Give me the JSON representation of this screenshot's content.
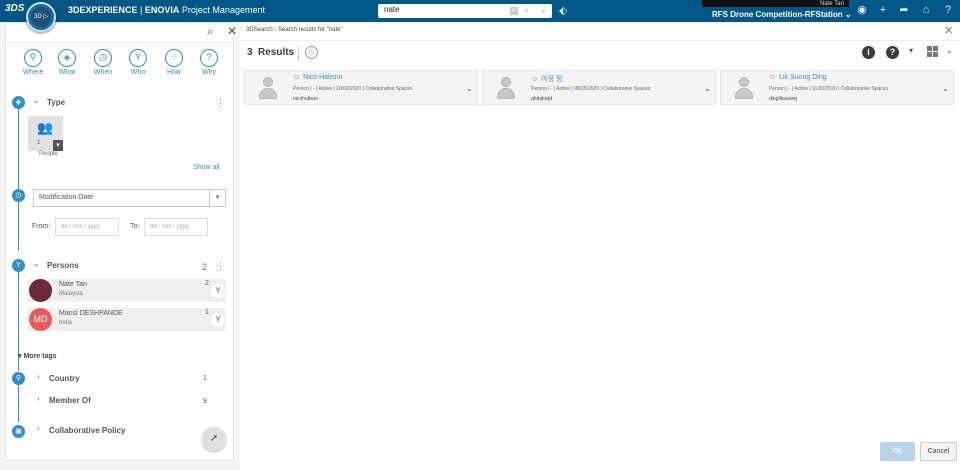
{
  "topbar": {
    "logo": "3DS",
    "compass_label": "3D  ▷  V,R",
    "brand": "3DEXPERIENCE",
    "app": "ENOVIA",
    "app_name": "Project Management",
    "search_value": "nate",
    "user": "Nate Tan",
    "collab_space": "RFS Drone Competition-RFStation",
    "icons": [
      "tag-icon",
      "user-icon",
      "plus-icon",
      "share-icon",
      "home-icon",
      "help-icon"
    ]
  },
  "filters": {
    "wtabs": [
      {
        "label": "Where",
        "icon": "location-icon"
      },
      {
        "label": "What",
        "icon": "cube-icon"
      },
      {
        "label": "When",
        "icon": "clock-icon"
      },
      {
        "label": "Who",
        "icon": "person-filter-icon"
      },
      {
        "label": "How",
        "icon": "network-icon"
      },
      {
        "label": "Why",
        "icon": "question-icon"
      }
    ],
    "type": {
      "title": "Type",
      "tile_count": "1",
      "tile_label": "People",
      "show_all": "Show all"
    },
    "modification": {
      "select_value": "Modification Date",
      "from_label": "From:",
      "to_label": "To:",
      "from_placeholder": "dd / mm / yyyy",
      "to_placeholder": "dd / mm / yyyy"
    },
    "persons": {
      "title": "Persons",
      "count": "2",
      "items": [
        {
          "name": "Nate Tan",
          "country": "Malaysia",
          "count": "2",
          "avatar_text": ""
        },
        {
          "name": "Mansi DESHPANDE",
          "country": "India",
          "count": "1",
          "avatar_text": "MD"
        }
      ]
    },
    "more_tags": "More tags",
    "sub_tags": [
      {
        "label": "Country",
        "count": "1"
      },
      {
        "label": "Member Of",
        "count": "9"
      }
    ],
    "collab_policy": "Collaborative Policy"
  },
  "results": {
    "header_title": "3DSearch - Search results for \"nate\"",
    "count": "3",
    "label": "Results",
    "cards": [
      {
        "name": "Nico Halisno",
        "meta": "Person | - | Active | 10/09/2020 | Collaborative Spaces",
        "login": "nicohalisno"
      },
      {
        "name": "아정 정",
        "meta": "Person | - | Active | 08/25/2020 | Collaborative Spaces",
        "login": "qhdgkwjd"
      },
      {
        "name": "Lik Suong Ding",
        "meta": "Person | - | Active | 11/30/2020 | Collaborative Spaces",
        "login": "dinglikauong"
      }
    ],
    "ok_label": "OK",
    "cancel_label": "Cancel"
  },
  "colors": {
    "topbar": "#005686",
    "accent": "#368ec4",
    "avatar_md": "#e65c5c"
  }
}
